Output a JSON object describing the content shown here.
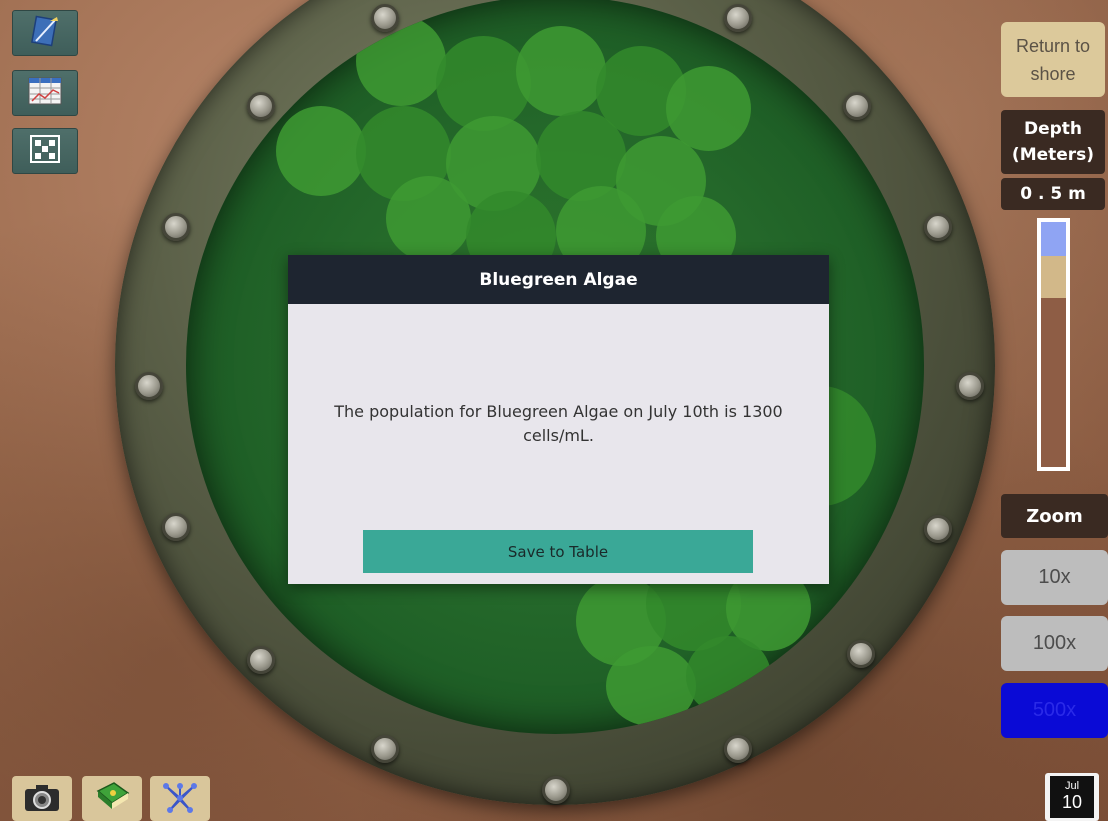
{
  "scene": {
    "label": "microscope porthole view",
    "glass_color": "#24682a",
    "algae_color": "#3e9a32"
  },
  "tools": {
    "notebook_icon": "notebook-icon",
    "table_icon": "data-table-icon",
    "graph_icon": "dot-grid-icon"
  },
  "bottom_tools": {
    "camera_icon": "camera-icon",
    "guide_icon": "field-guide-icon",
    "food_web_icon": "food-web-icon"
  },
  "return_button": {
    "line1": "Return to",
    "line2": "shore"
  },
  "depth": {
    "title_line1": "Depth",
    "title_line2": "(Meters)",
    "value": "0 . 5 m",
    "level_fraction": 0.06,
    "colors": {
      "water": "#8fa4f3",
      "sand": "#d2b889",
      "sediment": "#8e5d45"
    }
  },
  "zoom": {
    "title": "Zoom",
    "options": [
      "10x",
      "100x",
      "500x"
    ],
    "selected": "500x",
    "accent": "#0a0ad6"
  },
  "date": {
    "month": "Jul",
    "day": "10"
  },
  "modal": {
    "title": "Bluegreen Algae",
    "message": "The population for Bluegreen Algae on July 10th is 1300 cells/mL.",
    "save_label": "Save to Table",
    "save_color": "#3aa897"
  }
}
